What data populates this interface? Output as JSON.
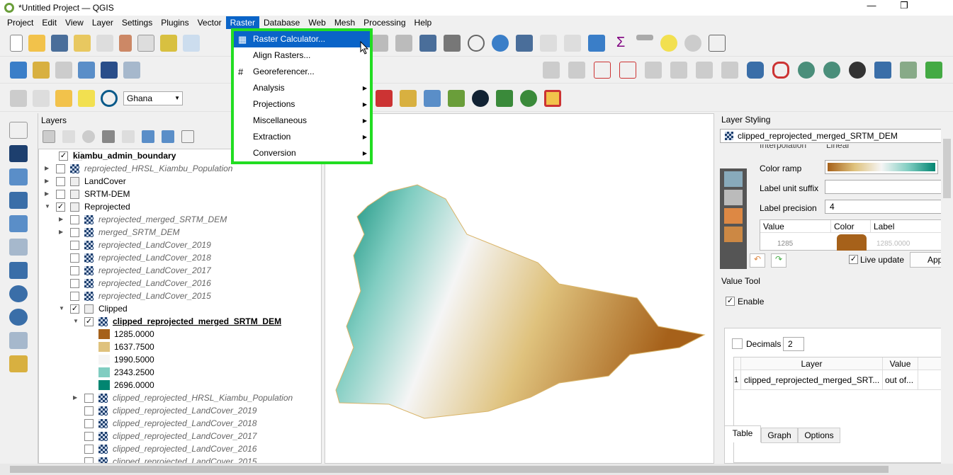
{
  "window": {
    "title": "*Untitled Project — QGIS",
    "minimize": "—",
    "restore": "❐"
  },
  "menubar": [
    "Project",
    "Edit",
    "View",
    "Layer",
    "Settings",
    "Plugins",
    "Vector",
    "Raster",
    "Database",
    "Web",
    "Mesh",
    "Processing",
    "Help"
  ],
  "raster_menu": {
    "items": [
      {
        "label": "Raster Calculator...",
        "selected": true
      },
      {
        "label": "Align Rasters..."
      },
      {
        "label": "Georeferencer..."
      },
      {
        "label": "Analysis",
        "submenu": true
      },
      {
        "label": "Projections",
        "submenu": true
      },
      {
        "label": "Miscellaneous",
        "submenu": true
      },
      {
        "label": "Extraction",
        "submenu": true
      },
      {
        "label": "Conversion",
        "submenu": true
      }
    ]
  },
  "toolbar": {
    "locator_value": "Ghana"
  },
  "layers_panel": {
    "title": "Layers",
    "rows": [
      {
        "label": "kiambu_admin_boundary",
        "checked": true,
        "style": "bold"
      },
      {
        "label": "reprojected_HRSL_Kiambu_Population",
        "checked": false,
        "style": "italic"
      },
      {
        "label": "LandCover",
        "checked": false,
        "style": "group"
      },
      {
        "label": "SRTM-DEM",
        "checked": false,
        "style": "group"
      },
      {
        "label": "Reprojected",
        "checked": true,
        "style": "group"
      },
      {
        "label": "reprojected_merged_SRTM_DEM",
        "checked": false,
        "style": "italic"
      },
      {
        "label": "merged_SRTM_DEM",
        "checked": false,
        "style": "italic"
      },
      {
        "label": "reprojected_LandCover_2019",
        "checked": false,
        "style": "italic"
      },
      {
        "label": "reprojected_LandCover_2018",
        "checked": false,
        "style": "italic"
      },
      {
        "label": "reprojected_LandCover_2017",
        "checked": false,
        "style": "italic"
      },
      {
        "label": "reprojected_LandCover_2016",
        "checked": false,
        "style": "italic"
      },
      {
        "label": "reprojected_LandCover_2015",
        "checked": false,
        "style": "italic"
      },
      {
        "label": "Clipped",
        "checked": true,
        "style": "group"
      },
      {
        "label": "clipped_reprojected_merged_SRTM_DEM",
        "checked": true,
        "style": "active"
      }
    ],
    "legend": [
      {
        "value": "1285.0000",
        "color": "#a6611a"
      },
      {
        "value": "1637.7500",
        "color": "#dfc27d"
      },
      {
        "value": "1990.5000",
        "color": "#f5f5f5"
      },
      {
        "value": "2343.2500",
        "color": "#80cdc1"
      },
      {
        "value": "2696.0000",
        "color": "#018571"
      }
    ],
    "rows_after": [
      {
        "label": "clipped_reprojected_HRSL_Kiambu_Population",
        "checked": false
      },
      {
        "label": "clipped_reprojected_LandCover_2019",
        "checked": false
      },
      {
        "label": "clipped_reprojected_LandCover_2018",
        "checked": false
      },
      {
        "label": "clipped_reprojected_LandCover_2017",
        "checked": false
      },
      {
        "label": "clipped_reprojected_LandCover_2016",
        "checked": false
      },
      {
        "label": "clipped_reprojected_LandCover_2015",
        "checked": false
      }
    ]
  },
  "layer_styling": {
    "title": "Layer Styling",
    "layer": "clipped_reprojected_merged_SRTM_DEM",
    "interpolation_label": "Interpolation",
    "interpolation_value": "Linear",
    "color_ramp_label": "Color ramp",
    "label_unit_suffix_label": "Label unit suffix",
    "label_unit_suffix_value": "",
    "label_precision_label": "Label precision",
    "label_precision_value": "4",
    "table_headers": [
      "Value",
      "Color",
      "Label"
    ],
    "first_value": "1285",
    "first_label": "1285.0000",
    "live_update_label": "Live update",
    "live_update": true,
    "apply_label": "Apply"
  },
  "value_tool": {
    "title": "Value Tool",
    "enable_label": "Enable",
    "enabled": true,
    "tabs": [
      "Table",
      "Graph",
      "Options"
    ],
    "active_tab": "Table",
    "decimals_label": "Decimals",
    "decimals_checked": false,
    "decimals_value": "2",
    "headers": [
      "Layer",
      "Value"
    ],
    "rows": [
      {
        "n": "1",
        "layer": "clipped_reprojected_merged_SRT...",
        "value": "out of..."
      }
    ]
  }
}
